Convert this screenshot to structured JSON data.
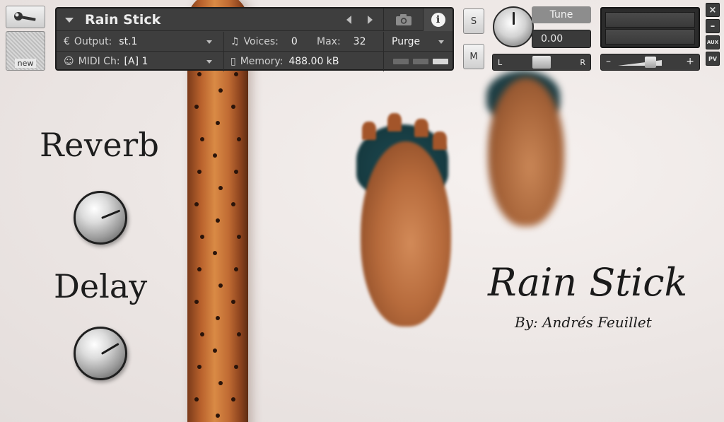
{
  "header": {
    "instrument_name": "Rain Stick",
    "output_label": "Output:",
    "output_value": "st.1",
    "voices_label": "Voices:",
    "voices_value": "0",
    "max_label": "Max:",
    "max_value": "32",
    "purge_label": "Purge",
    "midi_label": "MIDI Ch:",
    "midi_value": "[A]  1",
    "memory_label": "Memory:",
    "memory_value": "488.00 kB",
    "info_glyph": "i"
  },
  "toolbar": {
    "new_label": "new"
  },
  "channel": {
    "solo_label": "S",
    "mute_label": "M",
    "tune_label": "Tune",
    "tune_value": "0.00",
    "pan_left": "L",
    "pan_right": "R",
    "vol_minus": "–",
    "vol_plus": "+"
  },
  "window_buttons": {
    "close": "×",
    "minimize": "–",
    "aux": "AUX",
    "pv": "PV"
  },
  "controls": {
    "reverb_label": "Reverb",
    "delay_label": "Delay",
    "reverb_value": 0.75,
    "delay_value": 0.72
  },
  "branding": {
    "title": "Rain Stick",
    "byline": "By: Andrés Feuillet"
  },
  "colors": {
    "panel_bg": "#3e3e3e",
    "stick_wood": "#c06b33",
    "mask_hair": "#1d4a52",
    "wall": "#efe9e7"
  }
}
